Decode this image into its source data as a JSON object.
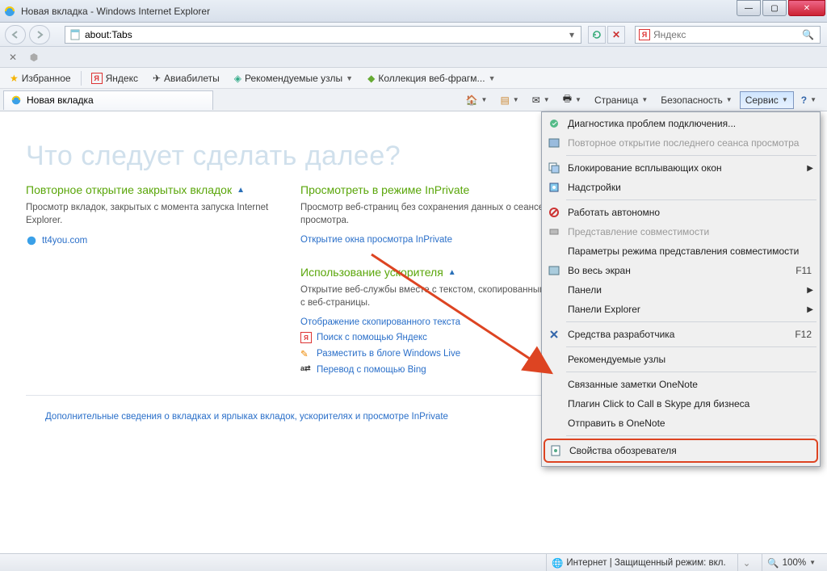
{
  "window": {
    "title": "Новая вкладка - Windows Internet Explorer",
    "address": "about:Tabs",
    "search_placeholder": "",
    "search_engine": "Яндекс"
  },
  "favorites_bar": {
    "button_label": "Избранное",
    "links": [
      "Яндекс",
      "Авиабилеты",
      "Рекомендуемые узлы",
      "Коллекция веб-фрагм..."
    ]
  },
  "tab": {
    "title": "Новая вкладка"
  },
  "commandbar": {
    "page": "Страница",
    "safety": "Безопасность",
    "service": "Сервис"
  },
  "page": {
    "heading": "Что следует сделать далее?",
    "sections": {
      "reopen": {
        "title": "Повторное открытие закрытых вкладок",
        "desc": "Просмотр вкладок, закрытых с момента запуска Internet Explorer.",
        "links": [
          "tt4you.com"
        ]
      },
      "inprivate": {
        "title": "Просмотреть в режиме InPrivate",
        "desc": "Просмотр веб-страниц без сохранения данных о сеансе просмотра.",
        "links": [
          "Открытие окна просмотра InPrivate"
        ]
      },
      "accelerator": {
        "title": "Использование ускорителя",
        "desc": "Открытие веб-службы вместе с текстом, скопированным с веб-страницы.",
        "note": "Отображение скопированного текста",
        "links": [
          "Поиск с помощью Яндекс",
          "Разместить в блоге Windows Live",
          "Перевод с помощью Bing"
        ]
      }
    },
    "footer_link": "Дополнительные сведения о вкладках и ярлыках вкладок, ускорителях и просмотре InPrivate"
  },
  "service_menu": {
    "items": [
      {
        "label": "Диагностика проблем подключения...",
        "icon": "diag",
        "disabled": false
      },
      {
        "label": "Повторное открытие последнего сеанса просмотра",
        "icon": "reopen",
        "disabled": true
      },
      {
        "sep": true
      },
      {
        "label": "Блокирование всплывающих окон",
        "icon": "popup",
        "submenu": true
      },
      {
        "label": "Надстройки",
        "icon": "addon"
      },
      {
        "sep": true
      },
      {
        "label": "Работать автономно",
        "icon": "offline"
      },
      {
        "label": "Представление совместимости",
        "icon": "compat",
        "disabled": true
      },
      {
        "label": "Параметры режима представления совместимости"
      },
      {
        "label": "Во весь экран",
        "icon": "fullscreen",
        "shortcut": "F11"
      },
      {
        "label": "Панели",
        "submenu": true
      },
      {
        "label": "Панели Explorer",
        "submenu": true
      },
      {
        "sep": true
      },
      {
        "label": "Средства разработчика",
        "icon": "devtools",
        "shortcut": "F12"
      },
      {
        "sep": true
      },
      {
        "label": "Рекомендуемые узлы"
      },
      {
        "sep": true
      },
      {
        "label": "Связанные заметки OneNote"
      },
      {
        "label": "Плагин Click to Call в Skype для бизнеса"
      },
      {
        "label": "Отправить в OneNote"
      },
      {
        "sep": true
      },
      {
        "label": "Свойства обозревателя",
        "icon": "props",
        "highlighted": true
      }
    ]
  },
  "statusbar": {
    "zone": "Интернет | Защищенный режим: вкл.",
    "zoom": "100%"
  }
}
